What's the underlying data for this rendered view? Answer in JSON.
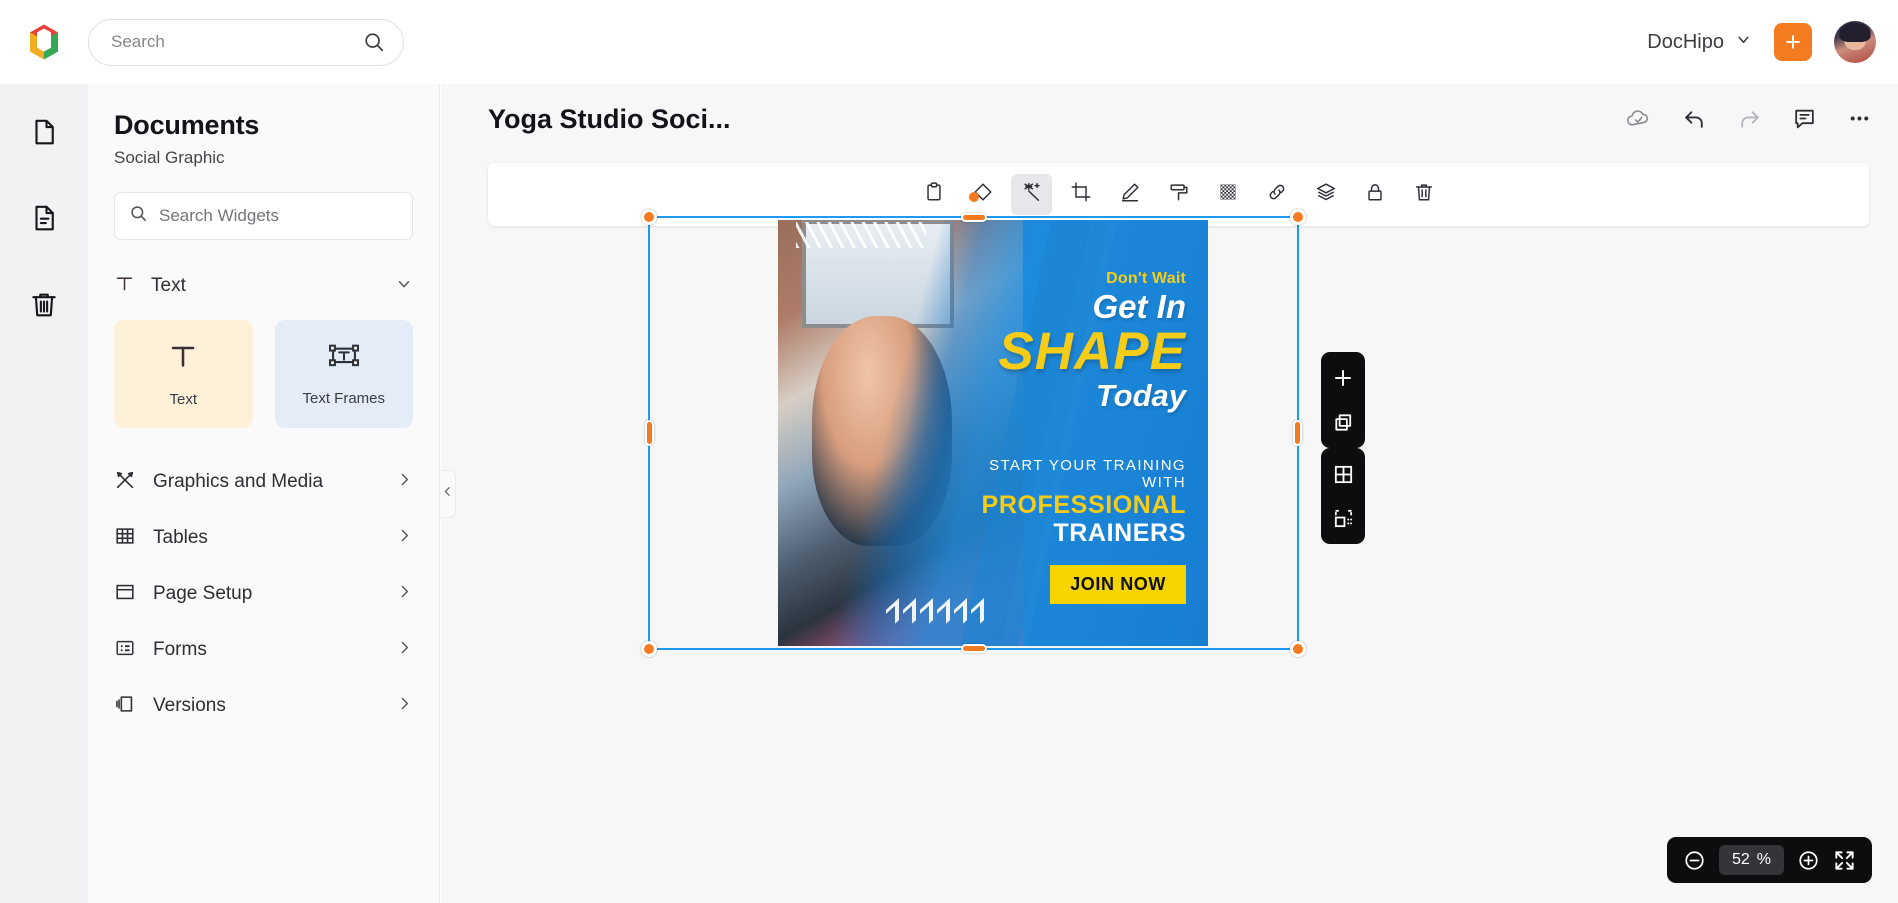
{
  "topbar": {
    "logo_name": "dochipo-logo",
    "search": {
      "value": "",
      "placeholder": "Search",
      "icon": "search-icon"
    },
    "workspace_name": "DocHipo",
    "workspace_chevron": "chevron-down-icon",
    "create_button_label": "+",
    "avatar_alt": "user-avatar"
  },
  "rail": {
    "items": [
      {
        "icon": "blank-document-icon",
        "active": false
      },
      {
        "icon": "document-lines-icon",
        "active": true
      },
      {
        "icon": "trash-icon",
        "active": false
      }
    ]
  },
  "panel": {
    "title": "Documents",
    "subtitle": "Social Graphic",
    "widget_search": {
      "value": "",
      "placeholder": "Search Widgets",
      "icon": "search-icon"
    },
    "text_section": {
      "label": "Text",
      "icon": "text-t-icon",
      "chevron": "chevron-down-icon",
      "cards": [
        {
          "label": "Text",
          "icon": "text-t-icon"
        },
        {
          "label": "Text Frames",
          "icon": "text-frame-icon"
        }
      ]
    },
    "menu": [
      {
        "label": "Graphics and Media",
        "icon": "graphics-media-icon",
        "chevron": "chevron-right-icon"
      },
      {
        "label": "Tables",
        "icon": "table-grid-icon",
        "chevron": "chevron-right-icon"
      },
      {
        "label": "Page Setup",
        "icon": "page-setup-icon",
        "chevron": "chevron-right-icon"
      },
      {
        "label": "Forms",
        "icon": "forms-icon",
        "chevron": "chevron-right-icon"
      },
      {
        "label": "Versions",
        "icon": "versions-layers-icon",
        "chevron": "chevron-right-icon"
      }
    ],
    "collapse_icon": "chevron-left-icon"
  },
  "workspace": {
    "document_title": "Yoga Studio Soci...",
    "actions": [
      {
        "icon": "cloud-saved-icon",
        "enabled": true
      },
      {
        "icon": "undo-icon",
        "enabled": true
      },
      {
        "icon": "redo-icon",
        "enabled": false
      },
      {
        "icon": "comment-icon",
        "enabled": true
      },
      {
        "icon": "more-options-icon",
        "enabled": true
      }
    ],
    "element_toolbar": [
      {
        "icon": "clipboard-icon",
        "active": false
      },
      {
        "icon": "eraser-icon",
        "active": false
      },
      {
        "icon": "magic-wand-icon",
        "active": true
      },
      {
        "icon": "crop-icon",
        "active": false
      },
      {
        "icon": "pencil-edit-icon",
        "active": false
      },
      {
        "icon": "paint-roller-icon",
        "active": false
      },
      {
        "icon": "transparency-icon",
        "active": false
      },
      {
        "icon": "link-icon",
        "active": false
      },
      {
        "icon": "layers-icon",
        "active": false
      },
      {
        "icon": "lock-icon",
        "active": false
      },
      {
        "icon": "delete-trash-icon",
        "active": false
      }
    ],
    "floating_stacks": [
      {
        "items": [
          {
            "icon": "add-plus-icon"
          },
          {
            "icon": "duplicate-icon"
          }
        ]
      },
      {
        "items": [
          {
            "icon": "grid-icon"
          },
          {
            "icon": "select-area-icon"
          }
        ]
      }
    ],
    "selection": {
      "handle_color": "#f47b20",
      "border_color": "#1e9bf0"
    },
    "zoom": {
      "minus_icon": "zoom-out-icon",
      "value": "52",
      "unit": "%",
      "plus_icon": "zoom-in-icon",
      "fit_icon": "fit-screen-icon"
    }
  },
  "design": {
    "dont_wait": "Don't Wait",
    "get_in": "Get In",
    "shape": "SHAPE",
    "today": "Today",
    "start_line": "START YOUR TRAINING WITH",
    "professional": "PROFESSIONAL",
    "trainers": "TRAINERS",
    "cta": "JOIN NOW",
    "accent_yellow": "#f5cd19",
    "accent_blue": "#1b86d8"
  }
}
